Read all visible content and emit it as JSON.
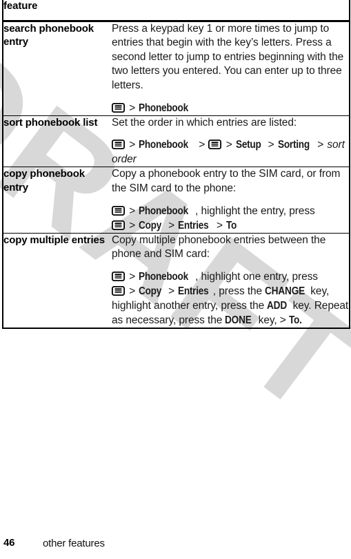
{
  "document": {
    "watermark": "DRAFT"
  },
  "table": {
    "header": {
      "feature_column": "feature",
      "description_column": ""
    },
    "rows": [
      {
        "feature": "search phonebook entry",
        "description": "Press a keypad key 1 or more times to jump to entries that begin with the key’s letters. Press a second letter to jump to entries beginning with the two letters you entered. You can enter up to three letters.",
        "path_label": "menu-key-icon > Phonebook",
        "path_items": [
          "Phonebook"
        ]
      },
      {
        "feature": "sort phonebook list",
        "description": "Set the order in which entries are listed:",
        "path_label": "menu-key-icon > Phonebook > menu-key-icon > Setup > Sorting > sort order",
        "path_items": [
          "Phonebook",
          "Setup",
          "Sorting",
          "sort order"
        ]
      },
      {
        "feature": "copy phonebook entry",
        "description": "Copy a phonebook entry to the SIM card, or from the SIM card to the phone:",
        "path_label": "menu-key-icon > Phonebook, highlight the entry, press menu-key-icon > Copy > Entries > To",
        "path_items": [
          "Phonebook",
          "Copy",
          "Entries",
          "To"
        ]
      },
      {
        "feature": "copy multiple entries",
        "description": "Copy multiple phonebook entries between the phone and SIM card:",
        "path_label": "menu-key-icon > Phonebook, highlight one entry, press menu-key-icon > Copy > Entries, press the CHANGE key, highlight another entry, press the ADD key. Repeat as necessary, press the DONE key, > To.",
        "path_items": [
          "Phonebook",
          "Copy",
          "Entries",
          "CHANGE",
          "ADD",
          "DONE",
          "To."
        ]
      }
    ],
    "inline_text": {
      "r1_sep": ">",
      "r2_sep": ">",
      "r2_tail_italic": "sort order",
      "r3_mid": ", highlight the entry, press",
      "r4_mid": ", highlight one entry, press",
      "r4_a": ", press the",
      "r4_b": "key,",
      "r4_c": "highlight another entry, press the",
      "r4_d": "key. Repeat as necessary, press the",
      "r4_e": "key, >"
    }
  },
  "footer": {
    "page_number": "46",
    "section_title": "other features"
  },
  "icons": {
    "menu_key": "menu-key-icon"
  },
  "colors": {
    "text": "#000000",
    "rule": "#000000",
    "watermark": "#d8d8d8",
    "background": "#ffffff"
  }
}
